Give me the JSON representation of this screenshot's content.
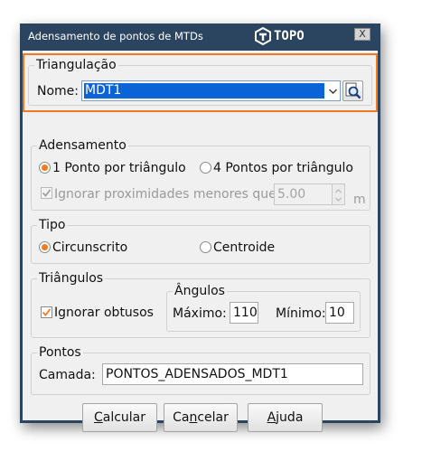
{
  "window": {
    "title": "Adensamento de pontos de MTDs",
    "logo_text": "TOPO",
    "close_label": "X"
  },
  "triangulacao": {
    "legend": "Triangulação",
    "nome_label": "Nome:",
    "nome_value": "MDT1"
  },
  "adensamento": {
    "legend": "Adensamento",
    "option1": "1 Ponto por triângulo",
    "option2": "4 Pontos por triângulo",
    "selected": "option1",
    "ignore_label": "Ignorar proximidades menores que:",
    "ignore_checked": true,
    "ignore_enabled": false,
    "distance_value": "5.00",
    "unit": "m"
  },
  "tipo": {
    "legend": "Tipo",
    "option1": "Circunscrito",
    "option2": "Centroide",
    "selected": "option1"
  },
  "triangulos": {
    "legend": "Triângulos",
    "ignorar_obtusos_label": "Ignorar obtusos",
    "ignorar_obtusos_checked": true,
    "angulos": {
      "legend": "Ângulos",
      "maximo_label": "Máximo:",
      "maximo_value": "110",
      "minimo_label": "Mínimo:",
      "minimo_value": "10"
    }
  },
  "pontos": {
    "legend": "Pontos",
    "camada_label": "Camada:",
    "camada_value": "PONTOS_ADENSADOS_MDT1"
  },
  "buttons": {
    "calcular_key": "C",
    "calcular_rest": "alcular",
    "cancelar_pre": "Ca",
    "cancelar_key": "n",
    "cancelar_rest": "celar",
    "ajuda_key": "A",
    "ajuda_rest": "juda"
  },
  "colors": {
    "title_bar": "#2b4460",
    "accent": "#f07a22",
    "selection": "#0a64d8"
  }
}
